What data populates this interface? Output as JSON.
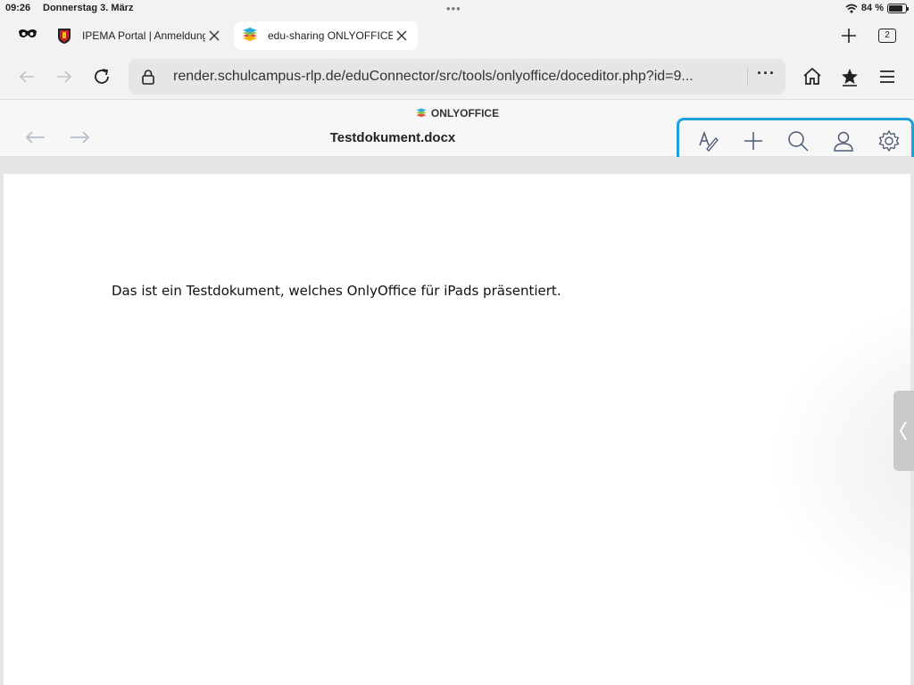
{
  "status": {
    "time": "09:26",
    "date": "Donnerstag 3. März",
    "battery": "84 %",
    "battery_level": 0.84
  },
  "tabs": [
    {
      "label": "IPEMA Portal | Anmeldung",
      "active": false,
      "icon": "crest-favicon"
    },
    {
      "label": "edu-sharing ONLYOFFICE",
      "active": true,
      "icon": "onlyoffice-favicon"
    }
  ],
  "tab_count": "2",
  "address": {
    "url": "render.schulcampus-rlp.de/eduConnector/src/tools/onlyoffice/doceditor.php?id=9...",
    "more": "···"
  },
  "editor": {
    "brand": "ONLYOFFICE",
    "file_name": "Testdokument.docx",
    "highlight_color": "#1ea0dc"
  },
  "document": {
    "text": "Das ist ein Testdokument, welches OnlyOffice für iPads präsentiert."
  }
}
